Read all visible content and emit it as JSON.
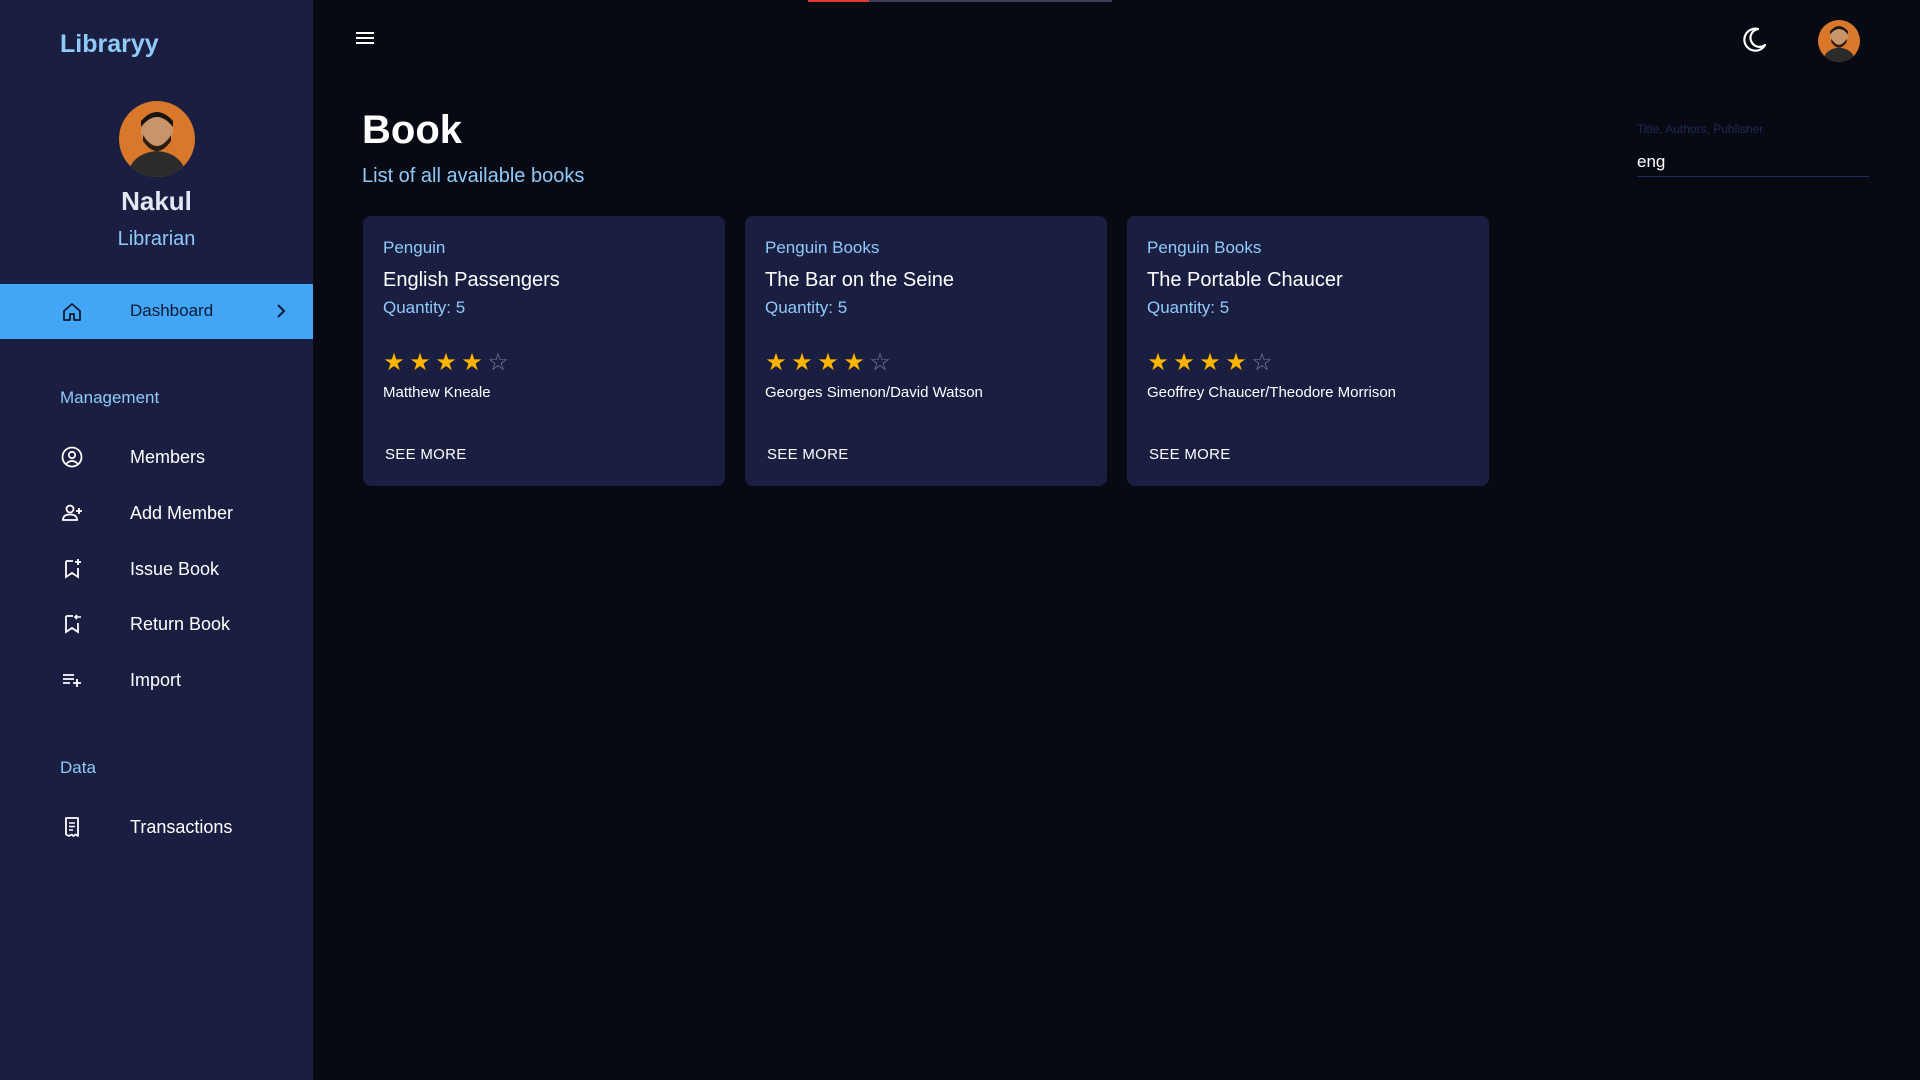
{
  "app": {
    "brand": "Libraryy"
  },
  "profile": {
    "name": "Nakul",
    "role": "Librarian"
  },
  "sidebar": {
    "active": {
      "label": "Dashboard",
      "icon": "home-icon"
    },
    "sections": [
      {
        "title": "Management",
        "items": [
          {
            "label": "Members",
            "icon": "account-circle-icon"
          },
          {
            "label": "Add Member",
            "icon": "person-add-icon"
          },
          {
            "label": "Issue Book",
            "icon": "bookmark-add-icon"
          },
          {
            "label": "Return Book",
            "icon": "bookmark-return-icon"
          },
          {
            "label": "Import",
            "icon": "playlist-add-icon"
          }
        ]
      },
      {
        "title": "Data",
        "items": [
          {
            "label": "Transactions",
            "icon": "receipt-icon"
          }
        ]
      }
    ]
  },
  "header": {
    "loading_progress": 0.2
  },
  "page": {
    "title": "Book",
    "subtitle": "List of all available books"
  },
  "search": {
    "placeholder": "Title, Authors, Publisher",
    "value": "eng"
  },
  "books": [
    {
      "publisher": "Penguin",
      "title": "English Passengers",
      "quantity": "Quantity: 5",
      "rating": 4,
      "max_rating": 5,
      "author": "Matthew Kneale",
      "action": "SEE MORE"
    },
    {
      "publisher": "Penguin Books",
      "title": "The Bar on the Seine",
      "quantity": "Quantity: 5",
      "rating": 4,
      "max_rating": 5,
      "author": "Georges Simenon/David Watson",
      "action": "SEE MORE"
    },
    {
      "publisher": "Penguin Books",
      "title": "The Portable Chaucer",
      "quantity": "Quantity: 5",
      "rating": 4,
      "max_rating": 5,
      "author": "Geoffrey Chaucer/Theodore Morrison",
      "action": "SEE MORE"
    }
  ],
  "colors": {
    "sidebar_bg": "#1a1f42",
    "page_bg": "#080a13",
    "accent": "#42a5f5",
    "accent_text": "#90caf9",
    "star": "#ffb400"
  }
}
